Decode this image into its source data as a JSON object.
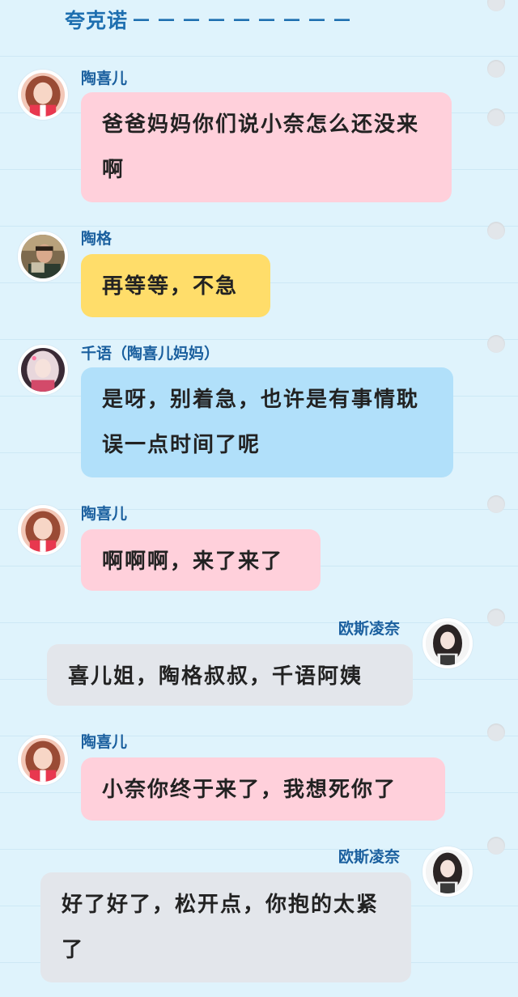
{
  "header": {
    "title": "夸克诺",
    "dashes": "－－－－－－－－－"
  },
  "messages": [
    {
      "sender": "陶喜儿",
      "text": "爸爸妈妈你们说小奈怎么还没来啊",
      "avatar": "xier-avatar",
      "color": "pink"
    },
    {
      "sender": "陶格",
      "text": "再等等，不急",
      "avatar": "tage-avatar",
      "color": "yellow"
    },
    {
      "sender": "千语（陶喜儿妈妈）",
      "text": "是呀，别着急，也许是有事情耽误一点时间了呢",
      "avatar": "qianyu-avatar",
      "color": "blue"
    },
    {
      "sender": "陶喜儿",
      "text": "啊啊啊，来了来了",
      "avatar": "xier-avatar",
      "color": "pink"
    },
    {
      "sender": "欧斯凌奈",
      "text": "喜儿姐，陶格叔叔，千语阿姨",
      "avatar": "lingnai-avatar",
      "color": "gray"
    },
    {
      "sender": "陶喜儿",
      "text": "小奈你终于来了，我想死你了",
      "avatar": "xier-avatar",
      "color": "pink"
    },
    {
      "sender": "欧斯凌奈",
      "text": "好了好了，松开点，你抱的太紧了",
      "avatar": "lingnai-avatar",
      "color": "gray"
    }
  ],
  "colors": {
    "background": "#dff3fc",
    "name": "#1a5f9e",
    "pink": "#ffd0db",
    "yellow": "#ffdd6a",
    "blue": "#b1e0fa",
    "gray": "#e3e6eb"
  }
}
